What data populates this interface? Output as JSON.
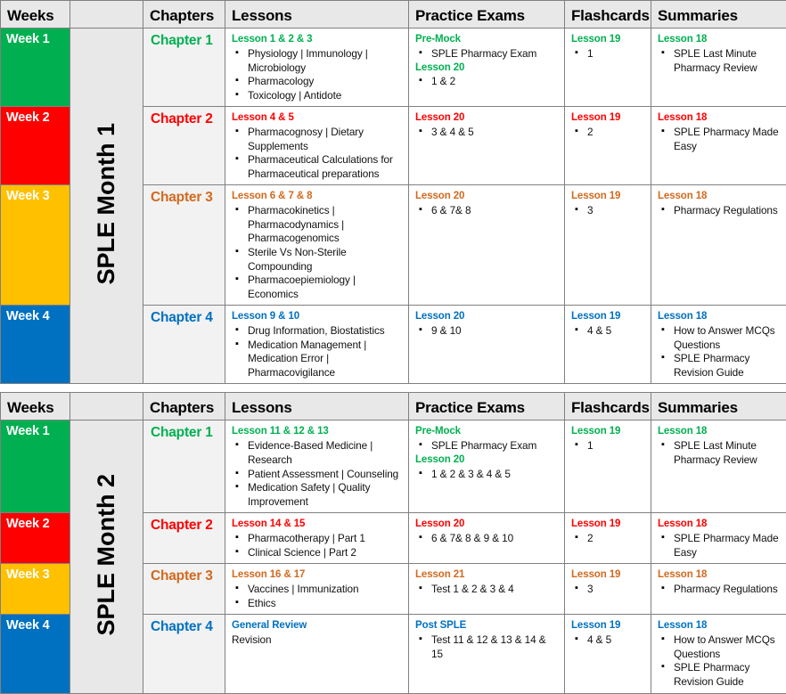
{
  "colors": {
    "green": "#00B050",
    "red": "#FF0000",
    "amber": "#FFC000",
    "blue": "#0070C0",
    "orange": "#D2691E",
    "header_bg": "#E8E8E8",
    "chapter_bg": "#F2F2F2",
    "border": "#808080"
  },
  "headers": {
    "weeks": "Weeks",
    "blank": "",
    "chapters": "Chapters",
    "lessons": "Lessons",
    "practice_exams": "Practice Exams",
    "flashcards": "Flashcards",
    "summaries": "Summaries"
  },
  "tables": [
    {
      "month_label": "SPLE Month 1",
      "rows": [
        {
          "week": "Week 1",
          "week_color": "#00B050",
          "accent": "#00B050",
          "chapter": "Chapter 1",
          "lessons_head": "Lesson 1 & 2 & 3",
          "lessons_items": [
            "Physiology | Immunology | Microbiology",
            "Pharmacology",
            "Toxicology | Antidote"
          ],
          "exams_head": "Pre-Mock",
          "exams_items": [
            "SPLE Pharmacy Exam"
          ],
          "exams_head2": "Lesson 20",
          "exams_items2": [
            "1 & 2"
          ],
          "flash_head": "Lesson 19",
          "flash_items": [
            "1"
          ],
          "summ_head": "Lesson 18",
          "summ_items": [
            "SPLE Last Minute Pharmacy Review"
          ]
        },
        {
          "week": "Week 2",
          "week_color": "#FF0000",
          "accent": "#FF0000",
          "chapter": "Chapter 2",
          "lessons_head": "Lesson 4 & 5",
          "lessons_items": [
            "Pharmacognosy | Dietary Supplements",
            "Pharmaceutical Calculations for Pharmaceutical preparations"
          ],
          "exams_head": "Lesson 20",
          "exams_items": [
            "3 & 4 & 5"
          ],
          "flash_head": "Lesson 19",
          "flash_items": [
            "2"
          ],
          "summ_head": "Lesson 18",
          "summ_items": [
            "SPLE Pharmacy Made Easy"
          ]
        },
        {
          "week": "Week 3",
          "week_color": "#FFC000",
          "accent": "#D2691E",
          "chapter": "Chapter 3",
          "lessons_head": "Lesson 6 & 7 & 8",
          "lessons_items": [
            "Pharmacokinetics | Pharmacodynamics | Pharmacogenomics",
            "Sterile Vs Non-Sterile Compounding",
            "Pharmacoepiemiology | Economics"
          ],
          "exams_head": "Lesson 20",
          "exams_items": [
            "6 & 7& 8"
          ],
          "flash_head": "Lesson 19",
          "flash_items": [
            "3"
          ],
          "summ_head": "Lesson 18",
          "summ_items": [
            "Pharmacy Regulations"
          ]
        },
        {
          "week": "Week 4",
          "week_color": "#0070C0",
          "accent": "#0070C0",
          "chapter": "Chapter 4",
          "lessons_head": "Lesson 9 & 10",
          "lessons_items": [
            "Drug Information, Biostatistics",
            "Medication Management | Medication Error | Pharmacovigilance"
          ],
          "exams_head": "Lesson 20",
          "exams_items": [
            "9 & 10"
          ],
          "flash_head": "Lesson 19",
          "flash_items": [
            "4 & 5"
          ],
          "summ_head": "Lesson 18",
          "summ_items": [
            "How to Answer MCQs Questions",
            "SPLE Pharmacy Revision Guide"
          ]
        }
      ]
    },
    {
      "month_label": "SPLE Month 2",
      "rows": [
        {
          "week": "Week 1",
          "week_color": "#00B050",
          "accent": "#00B050",
          "chapter": "Chapter 1",
          "lessons_head": "Lesson 11 & 12 & 13",
          "lessons_items": [
            "Evidence-Based Medicine | Research",
            "Patient Assessment | Counseling",
            "Medication Safety | Quality Improvement"
          ],
          "exams_head": "Pre-Mock",
          "exams_items": [
            "SPLE Pharmacy Exam"
          ],
          "exams_head2": "Lesson 20",
          "exams_items2": [
            "1 & 2 & 3 & 4 & 5"
          ],
          "flash_head": "Lesson 19",
          "flash_items": [
            "1"
          ],
          "summ_head": "Lesson 18",
          "summ_items": [
            "SPLE Last Minute Pharmacy Review"
          ]
        },
        {
          "week": "Week 2",
          "week_color": "#FF0000",
          "accent": "#FF0000",
          "chapter": "Chapter 2",
          "lessons_head": "Lesson 14 & 15",
          "lessons_items": [
            "Pharmacotherapy | Part 1",
            "Clinical Science | Part 2"
          ],
          "exams_head": "Lesson 20",
          "exams_items": [
            "6 & 7& 8 & 9 & 10"
          ],
          "flash_head": "Lesson 19",
          "flash_items": [
            "2"
          ],
          "summ_head": "Lesson 18",
          "summ_items": [
            "SPLE Pharmacy Made Easy"
          ]
        },
        {
          "week": "Week 3",
          "week_color": "#FFC000",
          "accent": "#D2691E",
          "chapter": "Chapter 3",
          "lessons_head": "Lesson 16 & 17",
          "lessons_items": [
            "Vaccines | Immunization",
            "Ethics"
          ],
          "exams_head": "Lesson 21",
          "exams_items": [
            "Test 1 & 2 & 3 & 4"
          ],
          "flash_head": "Lesson 19",
          "flash_items": [
            "3"
          ],
          "summ_head": "Lesson 18",
          "summ_items": [
            "Pharmacy Regulations"
          ]
        },
        {
          "week": "Week 4",
          "week_color": "#0070C0",
          "accent": "#0070C0",
          "chapter": "Chapter 4",
          "lessons_head": "General Review",
          "lessons_plain": "Revision",
          "lessons_items": [],
          "exams_head": "Post SPLE",
          "exams_items": [
            "Test 11 & 12 & 13 & 14 & 15"
          ],
          "flash_head": "Lesson 19",
          "flash_items": [
            "4 & 5"
          ],
          "summ_head": "Lesson 18",
          "summ_items": [
            "How to Answer MCQs Questions",
            "SPLE Pharmacy Revision Guide"
          ]
        }
      ]
    }
  ]
}
